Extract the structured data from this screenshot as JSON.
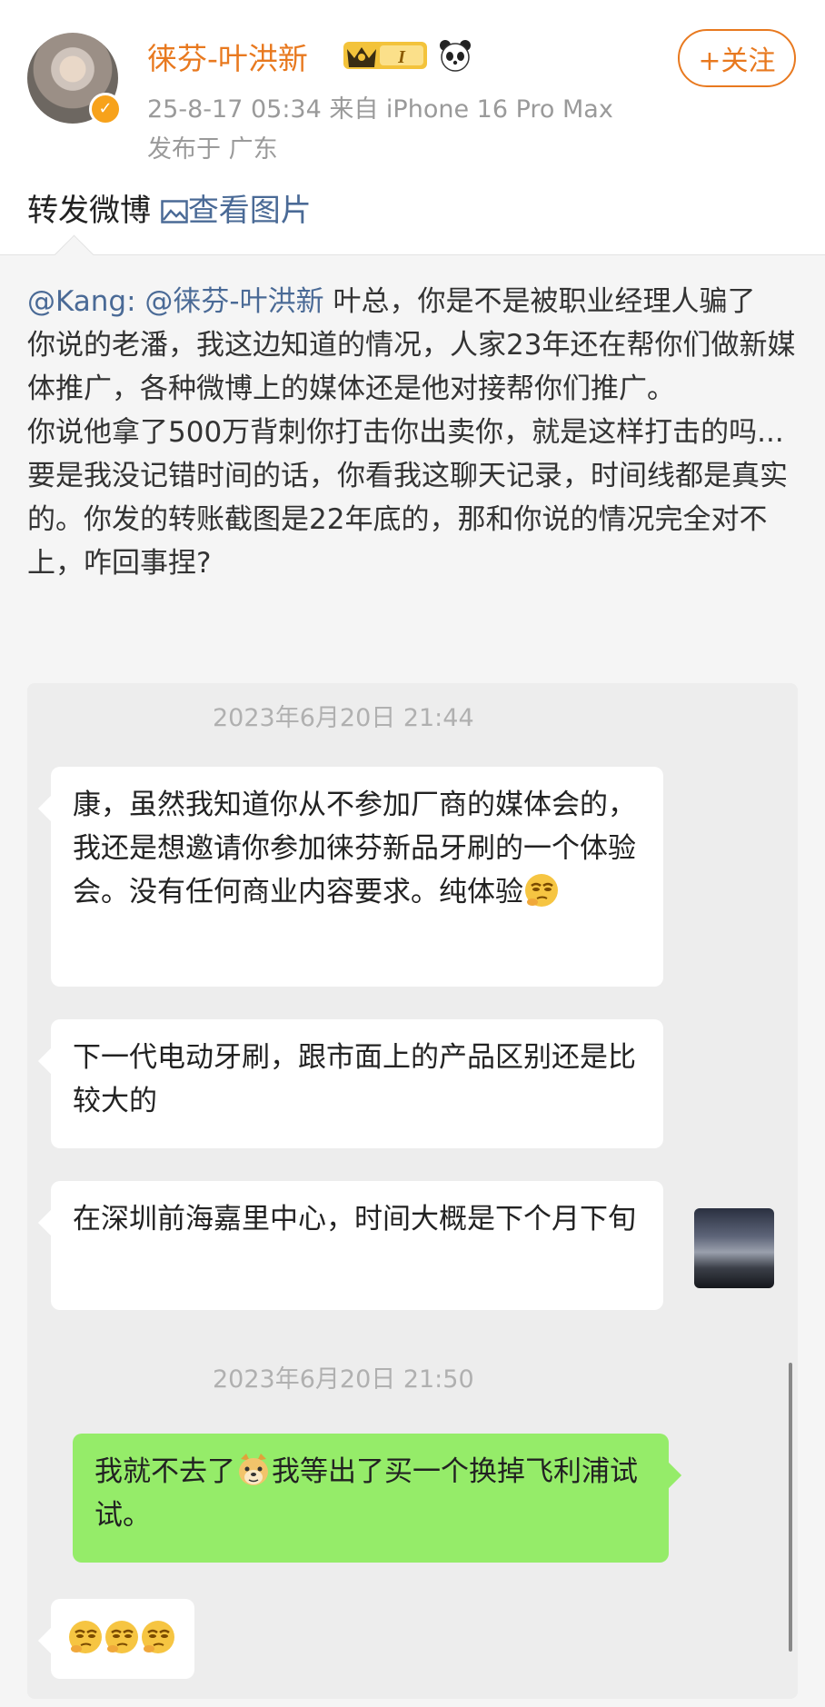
{
  "post": {
    "username": "徕芬-叶洪新",
    "meta_time_device": "25-8-17 05:34  来自 iPhone 16 Pro Max",
    "meta_location": "发布于 广东",
    "follow_label": "+关注",
    "vip_badge": "I",
    "repost_label": "转发微博",
    "view_images_label": "查看图片",
    "icons": [
      "avatar",
      "verified-badge-icon",
      "vip-crown-icon",
      "panda-icon",
      "image-icon"
    ]
  },
  "quote": {
    "author": "@Kang:",
    "mention": "@徕芬-叶洪新",
    "line1_rest": " 叶总，你是不是被职业经理人骗了",
    "para2": "你说的老潘，我这边知道的情况，人家23年还在帮你们做新媒体推广，各种微博上的媒体还是他对接帮你们推广。",
    "para3": "你说他拿了500万背刺你打击你出卖你，就是这样打击的吗...要是我没记错时间的话，你看我这聊天记录，时间线都是真实的。你发的转账截图是22年底的，那和你说的情况完全对不上，咋回事捏?"
  },
  "chat": {
    "timestamp1": "2023年6月20日 21:44",
    "msg1": "康，虽然我知道你从不参加厂商的媒体会的，我还是想邀请你参加徕芬新品牙刷的一个体验会。没有任何商业内容要求。纯体验",
    "msg2": "下一代电动牙刷，跟市面上的产品区别还是比较大的",
    "msg3": "在深圳前海嘉里中心，时间大概是下个月下旬",
    "timestamp2": "2023年6月20日 21:50",
    "msg4_a": "我就不去了",
    "msg4_b": "我等出了买一个换掉飞利浦试试。",
    "emoji_names": [
      "thinking-face-icon",
      "doge-icon",
      "thinking-face-icon",
      "thinking-face-icon",
      "thinking-face-icon"
    ]
  },
  "colors": {
    "accent_orange": "#e8791f",
    "link_blue": "#4a6a96",
    "wechat_green": "#95ec69",
    "gray_text": "#9a9a9a"
  }
}
